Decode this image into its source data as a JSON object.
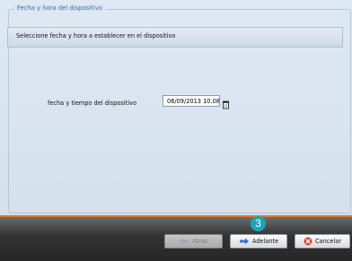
{
  "group": {
    "title": "Fecha y hora del dispositivo"
  },
  "instruction": "Seleccione fecha y hora a establecer en el dispositivo",
  "field": {
    "label": "fecha y tiempo del dispositivo",
    "value": "06/09/2013 10.08",
    "icon": "calendar-icon"
  },
  "buttons": {
    "back": {
      "label": "Atrás",
      "icon": "arrow-left-icon",
      "enabled": false
    },
    "next": {
      "label": "Adelante",
      "icon": "arrow-right-icon",
      "enabled": true
    },
    "cancel": {
      "label": "Cancelar",
      "icon": "cancel-icon",
      "enabled": true
    }
  },
  "callout": {
    "step": "3"
  },
  "colors": {
    "accent_line": "#e8722a",
    "callout_badge": "#1aa6b2",
    "group_title": "#3f6fb0",
    "cancel_icon": "#e23b2e",
    "arrow_icon": "#3a6fd8"
  }
}
